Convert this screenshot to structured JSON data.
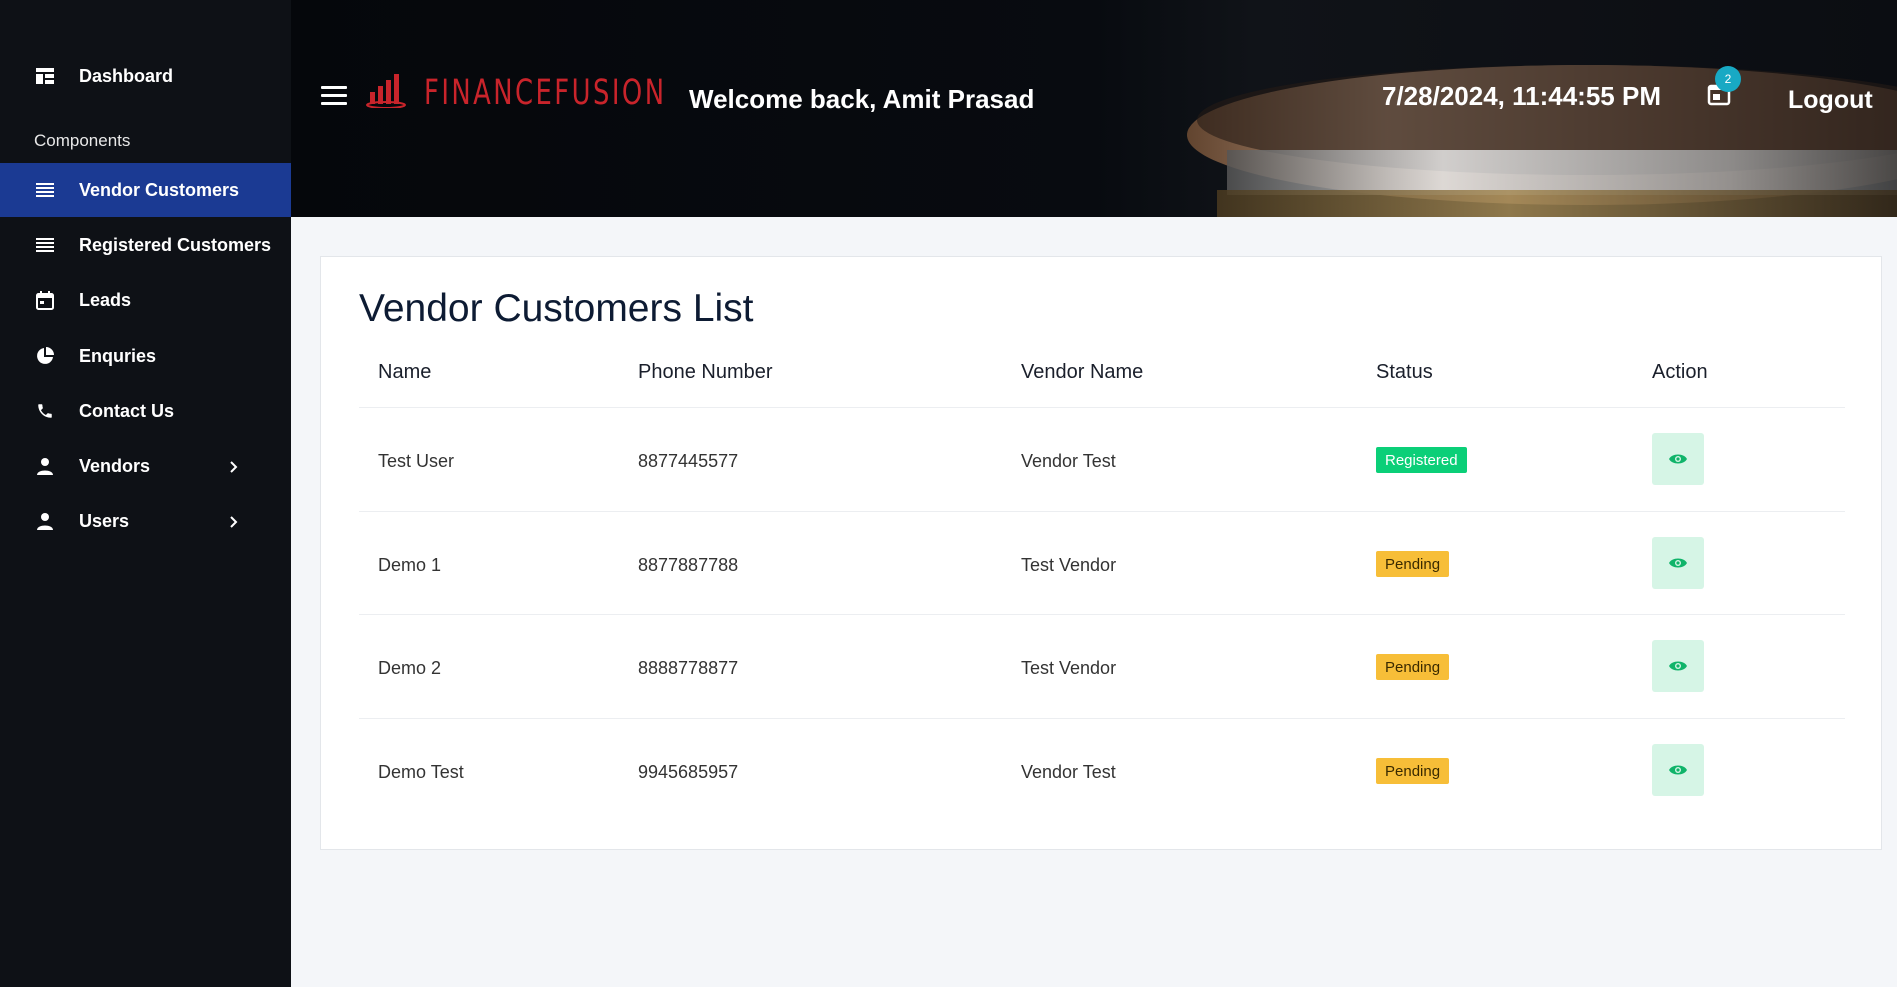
{
  "sidebar": {
    "dashboard_label": "Dashboard",
    "section_label": "Components",
    "items": [
      {
        "label": "Vendor Customers",
        "icon": "list-icon",
        "active": true
      },
      {
        "label": "Registered Customers",
        "icon": "list-icon"
      },
      {
        "label": "Leads",
        "icon": "calendar-icon"
      },
      {
        "label": "Enquries",
        "icon": "pie-chart-icon"
      },
      {
        "label": "Contact Us",
        "icon": "phone-icon"
      },
      {
        "label": "Vendors",
        "icon": "person-icon",
        "expandable": true
      },
      {
        "label": "Users",
        "icon": "person-icon",
        "expandable": true
      }
    ]
  },
  "header": {
    "brand": "FINANCEFUSION",
    "welcome": "Welcome back, Amit Prasad",
    "datetime": "7/28/2024, 11:44:55 PM",
    "notification_count": "2",
    "logout_label": "Logout"
  },
  "main": {
    "title": "Vendor Customers List",
    "columns": [
      "Name",
      "Phone Number",
      "Vendor Name",
      "Status",
      "Action"
    ],
    "rows": [
      {
        "name": "Test User",
        "phone": "8877445577",
        "vendor": "Vendor Test",
        "status": "Registered"
      },
      {
        "name": "Demo 1",
        "phone": "8877887788",
        "vendor": "Test Vendor",
        "status": "Pending"
      },
      {
        "name": "Demo 2",
        "phone": "8888778877",
        "vendor": "Test Vendor",
        "status": "Pending"
      },
      {
        "name": "Demo Test",
        "phone": "9945685957",
        "vendor": "Vendor Test",
        "status": "Pending"
      }
    ]
  },
  "colors": {
    "sidebar_bg": "#0e1116",
    "active_nav": "#1b3a93",
    "brand_red": "#c9242b",
    "status_registered": "#0bcf78",
    "status_pending": "#f7be38",
    "action_bg": "#d6f5e6",
    "action_icon": "#10b46a",
    "badge": "#18a9c4"
  }
}
